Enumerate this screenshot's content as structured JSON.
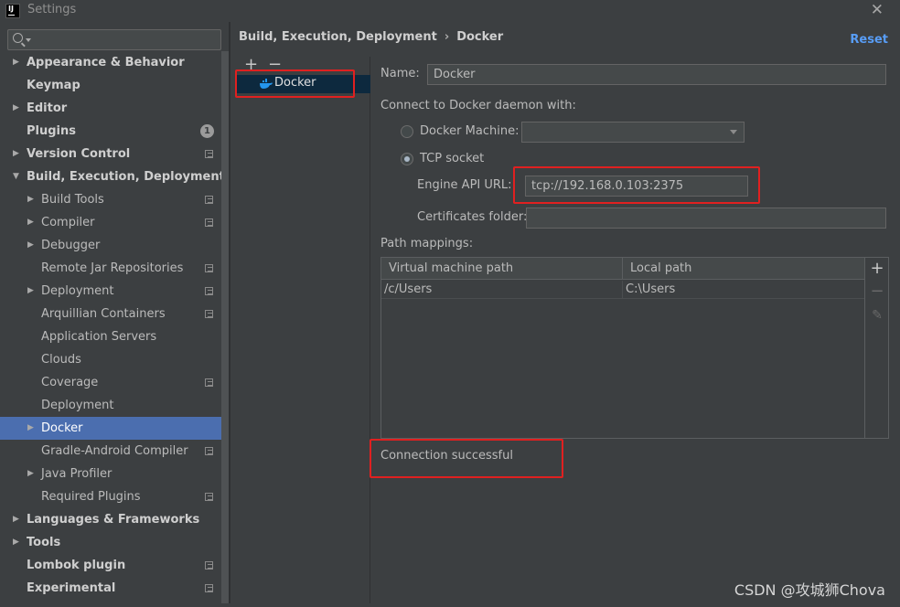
{
  "window": {
    "title": "Settings",
    "app_icon_text": "IJ",
    "close_glyph": "✕"
  },
  "sidebar": {
    "search": {
      "value": "",
      "placeholder": ""
    },
    "items": [
      {
        "label": "Appearance & Behavior",
        "level": 0,
        "arrow": "▶",
        "bold": true
      },
      {
        "label": "Keymap",
        "level": 0,
        "arrow": "",
        "bold": true
      },
      {
        "label": "Editor",
        "level": 0,
        "arrow": "▶",
        "bold": true
      },
      {
        "label": "Plugins",
        "level": 0,
        "arrow": "",
        "bold": true,
        "badge": "1"
      },
      {
        "label": "Version Control",
        "level": 0,
        "arrow": "▶",
        "bold": true,
        "project": true
      },
      {
        "label": "Build, Execution, Deployment",
        "level": 0,
        "arrow": "▼",
        "bold": true
      },
      {
        "label": "Build Tools",
        "level": 1,
        "arrow": "▶",
        "project": true
      },
      {
        "label": "Compiler",
        "level": 1,
        "arrow": "▶",
        "project": true
      },
      {
        "label": "Debugger",
        "level": 1,
        "arrow": "▶"
      },
      {
        "label": "Remote Jar Repositories",
        "level": 1,
        "arrow": "",
        "project": true
      },
      {
        "label": "Deployment",
        "level": 1,
        "arrow": "▶",
        "project": true
      },
      {
        "label": "Arquillian Containers",
        "level": 1,
        "arrow": "",
        "project": true
      },
      {
        "label": "Application Servers",
        "level": 1,
        "arrow": ""
      },
      {
        "label": "Clouds",
        "level": 1,
        "arrow": ""
      },
      {
        "label": "Coverage",
        "level": 1,
        "arrow": "",
        "project": true
      },
      {
        "label": "Deployment",
        "level": 1,
        "arrow": ""
      },
      {
        "label": "Docker",
        "level": 1,
        "arrow": "▶",
        "selected": true
      },
      {
        "label": "Gradle-Android Compiler",
        "level": 1,
        "arrow": "",
        "project": true
      },
      {
        "label": "Java Profiler",
        "level": 1,
        "arrow": "▶"
      },
      {
        "label": "Required Plugins",
        "level": 1,
        "arrow": "",
        "project": true
      },
      {
        "label": "Languages & Frameworks",
        "level": 0,
        "arrow": "▶",
        "bold": true
      },
      {
        "label": "Tools",
        "level": 0,
        "arrow": "▶",
        "bold": true
      },
      {
        "label": "Lombok plugin",
        "level": 0,
        "arrow": "",
        "bold": true,
        "project": true
      },
      {
        "label": "Experimental",
        "level": 0,
        "arrow": "",
        "bold": true,
        "project": true
      }
    ]
  },
  "header": {
    "breadcrumb_parent": "Build, Execution, Deployment",
    "breadcrumb_sep": "›",
    "breadcrumb_current": "Docker",
    "reset_label": "Reset"
  },
  "docker_list": {
    "add_glyph": "+",
    "remove_glyph": "−",
    "items": [
      "Docker"
    ]
  },
  "form": {
    "name_label": "Name:",
    "name_value": "Docker",
    "connect_label": "Connect to Docker daemon with:",
    "docker_machine_label": "Docker Machine:",
    "docker_machine_value": "",
    "tcp_socket_label": "TCP socket",
    "engine_api_label": "Engine API URL:",
    "engine_api_value": "tcp://192.168.0.103:2375",
    "certificates_label": "Certificates folder:",
    "certificates_value": "",
    "path_mappings_label": "Path mappings:",
    "status": "Connection successful"
  },
  "path_mappings": {
    "columns": [
      "Virtual machine path",
      "Local path"
    ],
    "rows": [
      [
        "/c/Users",
        "C:\\Users"
      ]
    ],
    "add_glyph": "+",
    "remove_glyph": "−",
    "edit_glyph": "✎"
  },
  "colors": {
    "background": "#3c3f41",
    "selection": "#4b6eaf",
    "link": "#589df6",
    "highlight_box": "#e02020",
    "docker_whale": "#2496ed"
  },
  "watermark": "CSDN @攻城狮Chova"
}
